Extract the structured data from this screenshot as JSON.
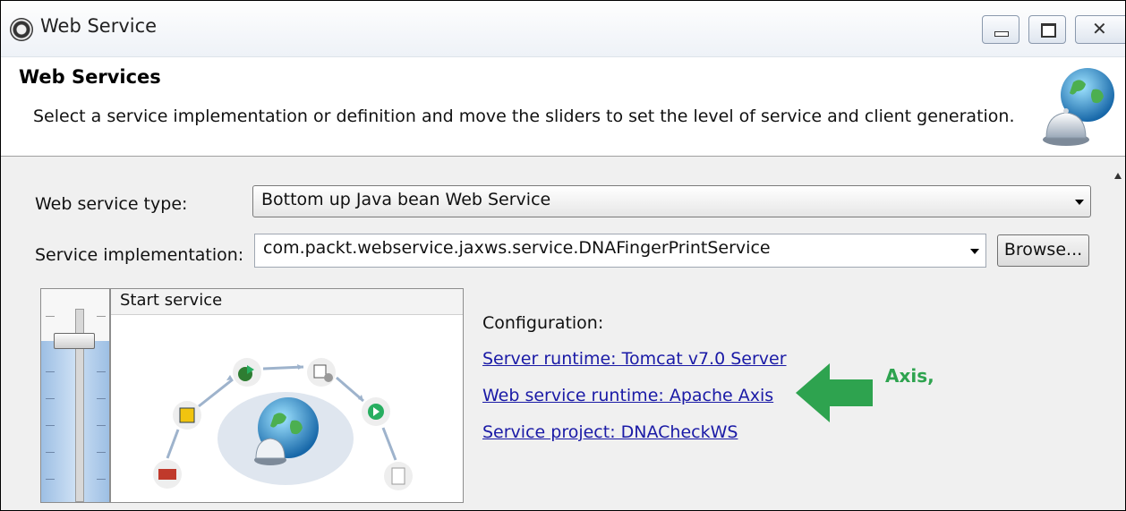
{
  "window": {
    "title": "Web Service",
    "controls": [
      "minimize",
      "maximize",
      "close"
    ]
  },
  "banner": {
    "title": "Web Services",
    "description": "Select a service implementation or definition and move the sliders to set the level of service and client generation.",
    "icon": "globe-bell-icon"
  },
  "form": {
    "service_type_label": "Web service type:",
    "service_type_value": "Bottom up Java bean Web Service",
    "service_impl_label": "Service implementation:",
    "service_impl_value": "com.packt.webservice.jaxws.service.DNAFingerPrintService",
    "browse_label": "Browse..."
  },
  "slider": {
    "level_label": "Start service",
    "level_fraction": 0.75
  },
  "configuration": {
    "label": "Configuration:",
    "links": [
      "Server runtime: Tomcat v7.0 Server",
      "Web service runtime: Apache Axis",
      "Service project: DNACheckWS"
    ]
  },
  "annotation": {
    "text": "Axis,",
    "color": "#2ea34f"
  }
}
